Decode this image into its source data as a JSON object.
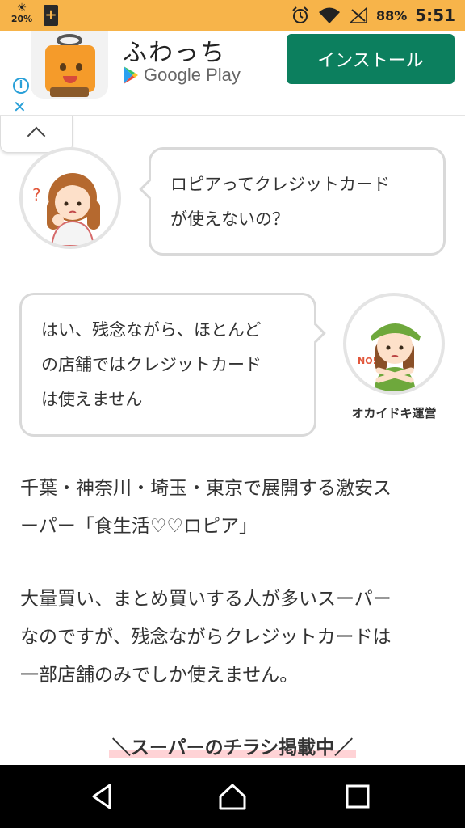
{
  "status_bar": {
    "weather_percent": "20%",
    "battery": "88%",
    "time": "5:51",
    "icons": [
      "weather-icon",
      "plus-icon",
      "alarm-icon",
      "wifi-icon",
      "no-signal-icon"
    ]
  },
  "ad": {
    "app_name": "ふわっち",
    "store": "Google Play",
    "install_label": "インストール",
    "info_icon": "info-icon",
    "close_icon": "close-icon",
    "install_color": "#0c7f5e"
  },
  "chat": {
    "question": {
      "lines": [
        "ロピアってクレジットカード",
        "が使えないの？"
      ],
      "avatar": "question-woman-avatar"
    },
    "answer": {
      "lines": [
        "はい、残念ながら、ほとんど",
        "の店舗ではクレジットカード",
        "は使えません"
      ],
      "avatar": "operator-avatar",
      "speaker": "オカイドキ運営"
    }
  },
  "article": {
    "para1": [
      "千葉・神奈川・埼玉・東京で展開する激安ス",
      "ーパー「食生活♡♡ロピア」"
    ],
    "para2": [
      "大量買い、まとめ買いする人が多いスーパー",
      "なのですが、残念ながらクレジットカードは",
      "一部店舗のみでしか使えません。"
    ],
    "promo_heading": "＼スーパーのチラシ掲載中／"
  },
  "colors": {
    "status_bar": "#f7b44a",
    "bubble_border": "#d9d9d9",
    "highlight": "#ffd3d6"
  },
  "nav": [
    "back-icon",
    "home-icon",
    "recents-icon"
  ]
}
